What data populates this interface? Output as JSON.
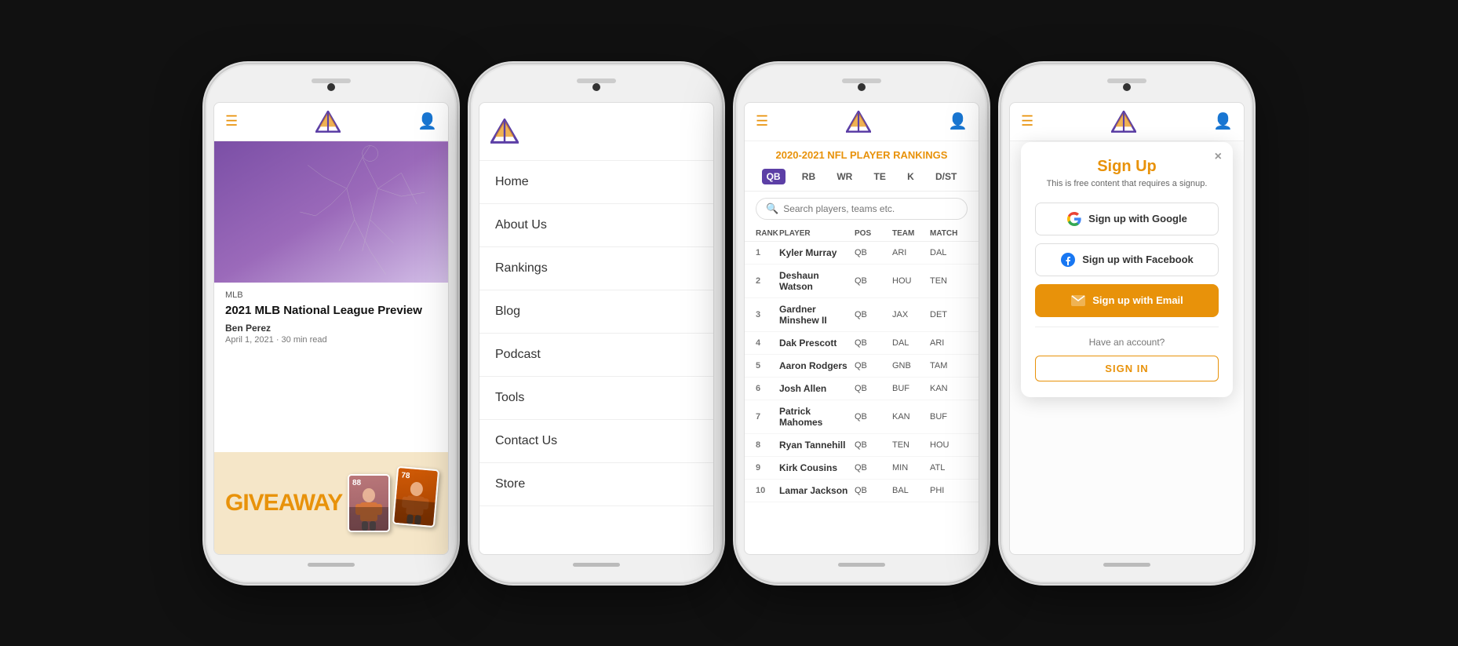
{
  "phone1": {
    "post": {
      "category": "MLB",
      "title": "2021 MLB National League Preview",
      "author": "Ben Perez",
      "meta": "April 1, 2021 · 30 min read",
      "giveaway_text": "GIVEAWAY",
      "card1_num": "88",
      "card2_num": "78"
    }
  },
  "phone2": {
    "menu_items": [
      "Home",
      "About Us",
      "Rankings",
      "Blog",
      "Podcast",
      "Tools",
      "Contact Us",
      "Store"
    ]
  },
  "phone3": {
    "rankings_title": "2020-2021 NFL PLAYER  RANKINGS",
    "position_tabs": [
      "QB",
      "RB",
      "WR",
      "TE",
      "K",
      "D/ST"
    ],
    "active_tab": "QB",
    "search_placeholder": "Search players, teams etc.",
    "table_headers": [
      "RANK",
      "PLAYER",
      "POSITION",
      "TEAM",
      "MATCH"
    ],
    "players": [
      {
        "rank": 1,
        "name": "Kyler Murray",
        "pos": "QB",
        "team": "ARI",
        "match": "DAL"
      },
      {
        "rank": 2,
        "name": "Deshaun Watson",
        "pos": "QB",
        "team": "HOU",
        "match": "TEN"
      },
      {
        "rank": 3,
        "name": "Gardner Minshew II",
        "pos": "QB",
        "team": "JAX",
        "match": "DET"
      },
      {
        "rank": 4,
        "name": "Dak Prescott",
        "pos": "QB",
        "team": "DAL",
        "match": "ARI"
      },
      {
        "rank": 5,
        "name": "Aaron Rodgers",
        "pos": "QB",
        "team": "GNB",
        "match": "TAM"
      },
      {
        "rank": 6,
        "name": "Josh Allen",
        "pos": "QB",
        "team": "BUF",
        "match": "KAN"
      },
      {
        "rank": 7,
        "name": "Patrick Mahomes",
        "pos": "QB",
        "team": "KAN",
        "match": "BUF"
      },
      {
        "rank": 8,
        "name": "Ryan Tannehill",
        "pos": "QB",
        "team": "TEN",
        "match": "HOU"
      },
      {
        "rank": 9,
        "name": "Kirk Cousins",
        "pos": "QB",
        "team": "MIN",
        "match": "ATL"
      },
      {
        "rank": 10,
        "name": "Lamar Jackson",
        "pos": "QB",
        "team": "BAL",
        "match": "PHI"
      }
    ]
  },
  "phone4": {
    "modal": {
      "title": "Sign Up",
      "subtitle": "This is free content that requires a signup.",
      "google_btn": "Sign up with Google",
      "facebook_btn": "Sign up with Facebook",
      "email_btn": "Sign up with Email",
      "have_account": "Have an account?",
      "sign_in": "SIGN IN",
      "close": "×"
    }
  },
  "colors": {
    "orange": "#e8920a",
    "purple": "#5c3fa6",
    "light_gray": "#f5f5f5"
  }
}
